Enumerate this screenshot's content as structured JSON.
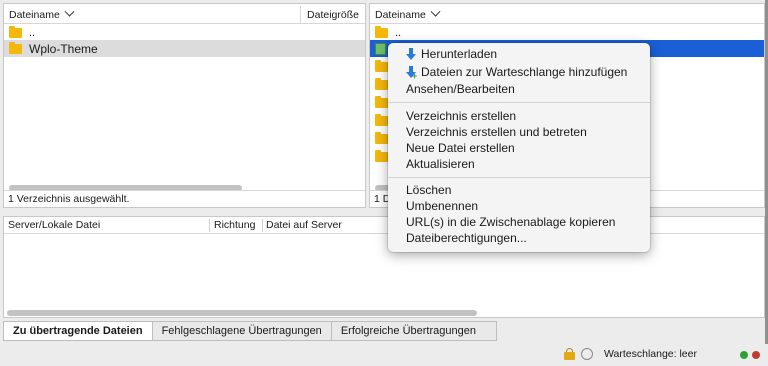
{
  "local_pane": {
    "header": {
      "filename": "Dateiname",
      "filesize": "Dateigröße"
    },
    "rows": [
      {
        "name": ".."
      },
      {
        "name": "Wplo-Theme"
      }
    ],
    "status": "1 Verzeichnis ausgewählt."
  },
  "remote_pane": {
    "header": {
      "filename": "Dateiname"
    },
    "rows": [
      {
        "name": ".."
      }
    ],
    "status": "1 D"
  },
  "context_menu": {
    "items": [
      {
        "label": "Herunterladen",
        "icon": "download-icon"
      },
      {
        "label": "Dateien zur Warteschlange hinzufügen",
        "icon": "add-to-queue-icon"
      },
      {
        "label": "Ansehen/Bearbeiten"
      },
      {
        "label": "Verzeichnis erstellen"
      },
      {
        "label": "Verzeichnis erstellen und betreten"
      },
      {
        "label": "Neue Datei erstellen"
      },
      {
        "label": "Aktualisieren"
      },
      {
        "label": "Löschen"
      },
      {
        "label": "Umbenennen"
      },
      {
        "label": "URL(s) in die Zwischenablage kopieren"
      },
      {
        "label": "Dateiberechtigungen..."
      }
    ]
  },
  "queue": {
    "headers": {
      "file": "Server/Lokale Datei",
      "direction": "Richtung",
      "remote": "Datei auf Server"
    }
  },
  "tabs": [
    {
      "label": "Zu übertragende Dateien",
      "active": true
    },
    {
      "label": "Fehlgeschlagene Übertragungen",
      "active": false
    },
    {
      "label": "Erfolgreiche Übertragungen",
      "active": false
    }
  ],
  "statusbar": {
    "queue_label": "Warteschlange: leer",
    "led_colors": [
      "#2e9e3a",
      "#c33a2e"
    ]
  },
  "colors": {
    "selection_blue": "#1b5fd6",
    "folder": "#f5b80a"
  }
}
